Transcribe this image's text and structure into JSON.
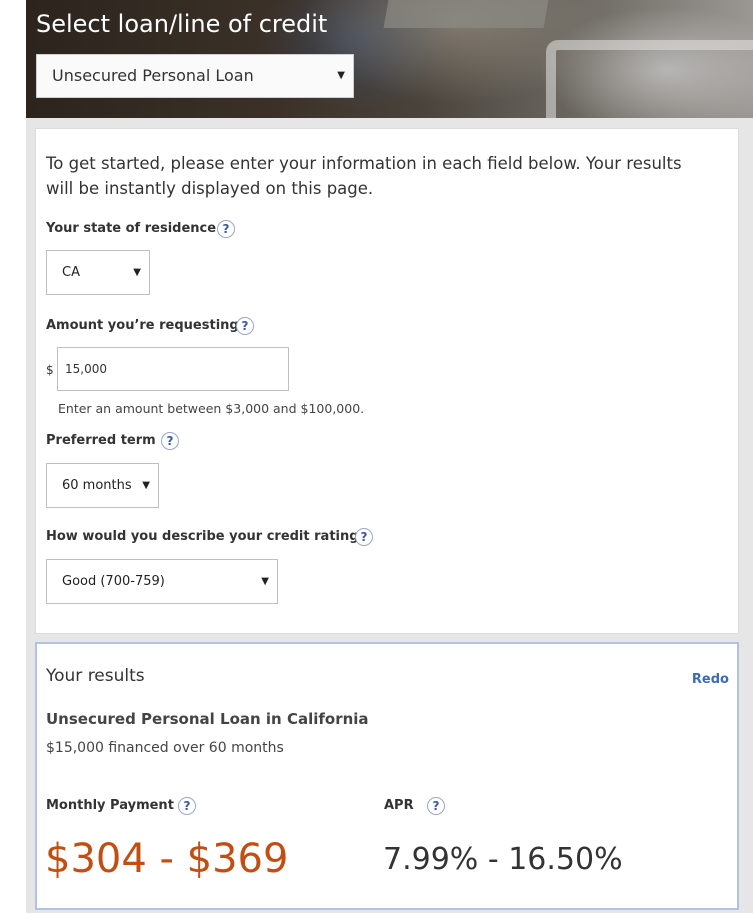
{
  "hero": {
    "title": "Select loan/line of credit",
    "loan_type": "Unsecured Personal Loan"
  },
  "form": {
    "intro": "To get started, please enter your information in each field below. Your results will be instantly displayed on this page.",
    "state": {
      "label": "Your state of residence",
      "value": "CA"
    },
    "amount": {
      "label": "Amount you’re requesting",
      "currency_symbol": "$",
      "value": "15,000",
      "hint": "Enter an amount between $3,000 and $100,000."
    },
    "term": {
      "label": "Preferred term",
      "value": "60 months"
    },
    "credit": {
      "label": "How would you describe your credit rating?",
      "value": "Good (700-759)"
    },
    "help_glyph": "?",
    "caret_glyph": "▼"
  },
  "results": {
    "title": "Your results",
    "redo_label": "Redo",
    "product": "Unsecured Personal Loan in California",
    "financed": "$15,000 financed over 60 months",
    "monthly_payment_label": "Monthly Payment",
    "monthly_payment_value": "$304 - $369",
    "apr_label": "APR",
    "apr_value": "7.99% - 16.50%"
  },
  "colors": {
    "payment": "#c24f12",
    "link": "#3d6cb4",
    "results_border": "#aec3e6"
  }
}
